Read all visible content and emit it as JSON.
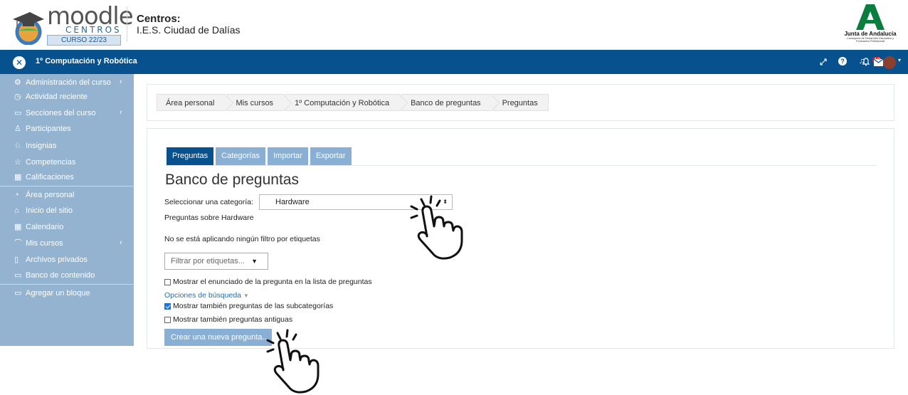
{
  "header": {
    "logo": {
      "wordmark": "moodle",
      "subtitle": "CENTROS",
      "badge": "CURSO 22/23"
    },
    "centros_label": "Centros:",
    "centro_name": "I.E.S. Ciudad de Dalías",
    "junta": {
      "title": "Junta de Andalucía",
      "subtitle": "Consejería de Desarrollo Educativo y Formación Profesional"
    }
  },
  "navbar": {
    "course_title": "1º Computación y Robótica",
    "icons": [
      "expand-icon",
      "help-icon",
      "bell-icon",
      "mail-icon",
      "avatar"
    ],
    "notification_count": "12"
  },
  "sidebar": {
    "items": [
      {
        "label": "Administración del curso",
        "icon": "gears-icon",
        "caret": true
      },
      {
        "label": "Actividad reciente",
        "icon": "clock-icon",
        "caret": false
      },
      {
        "label": "Secciones del curso",
        "icon": "folder-icon",
        "caret": true
      },
      {
        "label": "Participantes",
        "icon": "users-icon",
        "caret": false
      },
      {
        "label": "Insignias",
        "icon": "badge-icon",
        "caret": false
      },
      {
        "label": "Competencias",
        "icon": "star-icon",
        "caret": false
      },
      {
        "label": "Calificaciones",
        "icon": "table-icon",
        "caret": false
      },
      {
        "label": "Área personal",
        "icon": "dashboard-icon",
        "caret": false
      },
      {
        "label": "Inicio del sitio",
        "icon": "home-icon",
        "caret": false
      },
      {
        "label": "Calendario",
        "icon": "calendar-icon",
        "caret": false
      },
      {
        "label": "Mis cursos",
        "icon": "graduation-icon",
        "caret": true
      },
      {
        "label": "Archivos privados",
        "icon": "files-icon",
        "caret": false
      },
      {
        "label": "Banco de contenido",
        "icon": "folder-icon",
        "caret": false
      },
      {
        "label": "Agregar un bloque",
        "icon": "plus-square-icon",
        "caret": false
      }
    ]
  },
  "breadcrumb": [
    "Área personal",
    "Mis cursos",
    "1º Computación y Robótica",
    "Banco de preguntas",
    "Preguntas"
  ],
  "tabs": [
    {
      "label": "Preguntas",
      "active": true
    },
    {
      "label": "Categorías",
      "active": false
    },
    {
      "label": "Importar",
      "active": false
    },
    {
      "label": "Exportar",
      "active": false
    }
  ],
  "main": {
    "title": "Banco de preguntas",
    "category_label": "Seleccionar una categoría:",
    "category_value": "Hardware",
    "category_description": "Preguntas sobre Hardware",
    "tag_filter_status": "No se está aplicando ningún filtro por etiquetas",
    "tag_filter_placeholder": "Filtrar por etiquetas...",
    "show_question_text": {
      "label": "Mostrar el enunciado de la pregunta en la lista de preguntas",
      "checked": false
    },
    "search_options": "Opciones de búsqueda",
    "show_subcategories": {
      "label": "Mostrar también preguntas de las subcategorías",
      "checked": true
    },
    "show_old": {
      "label": "Mostrar también preguntas antiguas",
      "checked": false
    },
    "create_button": "Crear una nueva pregunta..."
  },
  "colors": {
    "navbar": "#07518e",
    "sidebar": "#93b3d1",
    "tab_active": "#07518e",
    "tab_inactive": "#89afd4",
    "link": "#1f6fb7",
    "badge": "#e21d1d"
  }
}
